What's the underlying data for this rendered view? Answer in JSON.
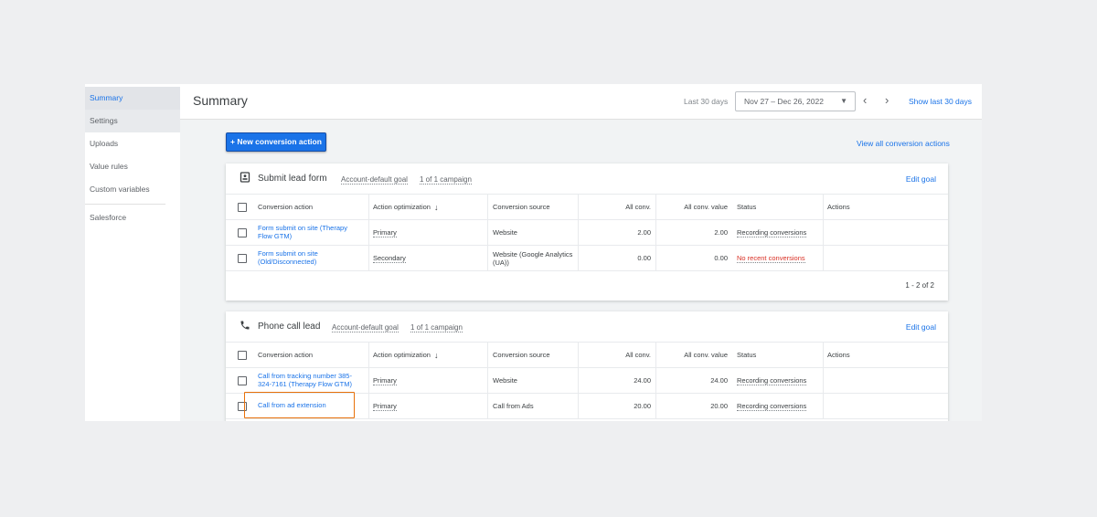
{
  "sidebar": {
    "items": [
      {
        "label": "Summary"
      },
      {
        "label": "Settings"
      },
      {
        "label": "Uploads"
      },
      {
        "label": "Value rules"
      },
      {
        "label": "Custom variables"
      },
      {
        "label": "Salesforce"
      }
    ]
  },
  "header": {
    "title": "Summary",
    "range_label": "Last 30 days",
    "date_range": "Nov 27 – Dec 26, 2022",
    "show_last": "Show last 30 days"
  },
  "toolbar": {
    "new_button": "+ New conversion action",
    "view_all": "View all conversion actions"
  },
  "table_headers": {
    "conversion_action": "Conversion action",
    "action_optimization": "Action optimization",
    "conversion_source": "Conversion source",
    "all_conv": "All conv.",
    "all_conv_value": "All conv. value",
    "status": "Status",
    "actions": "Actions"
  },
  "cards": [
    {
      "title": "Submit lead form",
      "goal_tag": "Account-default goal",
      "campaign_tag": "1 of 1 campaign",
      "edit": "Edit goal",
      "rows": [
        {
          "action": "Form submit on site (Therapy Flow GTM)",
          "optimization": "Primary",
          "source": "Website",
          "all_conv": "2.00",
          "all_conv_value": "2.00",
          "status": "Recording conversions"
        },
        {
          "action": "Form submit on site (Old/Disconnected)",
          "optimization": "Secondary",
          "source": "Website (Google Analytics (UA))",
          "all_conv": "0.00",
          "all_conv_value": "0.00",
          "status": "No recent conversions"
        }
      ],
      "pager": "1 - 2 of 2"
    },
    {
      "title": "Phone call lead",
      "goal_tag": "Account-default goal",
      "campaign_tag": "1 of 1 campaign",
      "edit": "Edit goal",
      "rows": [
        {
          "action": "Call from tracking number 385-324-7161 (Therapy Flow GTM)",
          "optimization": "Primary",
          "source": "Website",
          "all_conv": "24.00",
          "all_conv_value": "24.00",
          "status": "Recording conversions"
        },
        {
          "action": "Call from ad extension",
          "optimization": "Primary",
          "source": "Call from Ads",
          "all_conv": "20.00",
          "all_conv_value": "20.00",
          "status": "Recording conversions"
        }
      ]
    }
  ],
  "colors": {
    "accent": "#1a73e8",
    "highlight": "#e8710a",
    "error": "#d93025"
  }
}
